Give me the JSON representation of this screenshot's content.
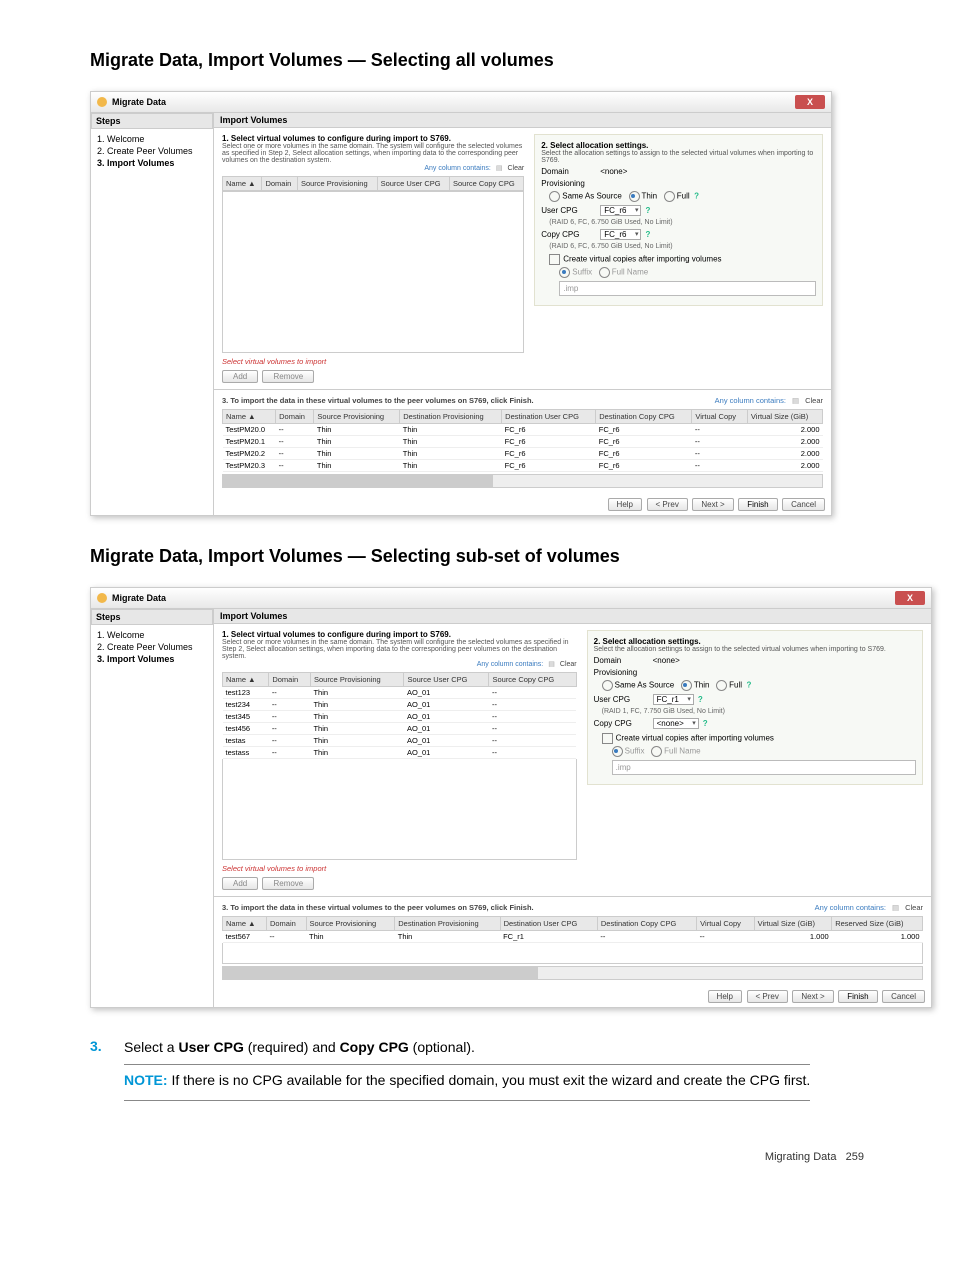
{
  "heading1": "Migrate Data, Import Volumes — Selecting all volumes",
  "heading2": "Migrate Data, Import Volumes — Selecting sub-set of volumes",
  "dlg": {
    "title": "Migrate Data",
    "close_x": "X",
    "steps_hdr": "Steps",
    "steps": [
      "1. Welcome",
      "2. Create Peer Volumes",
      "3. Import Volumes"
    ],
    "panel_hdr": "Import Volumes",
    "sec1_bold": "1. Select virtual volumes to configure during import to S769.",
    "sec1_line1": "Select one or more volumes in the same domain. The system will configure the selected volumes as specified in Step 2, Select allocation settings, when importing data to the corresponding peer volumes on the destination system.",
    "any_col": "Any column contains:",
    "clear": "Clear",
    "cols_top": [
      "Name ▲",
      "Domain",
      "Source Provisioning",
      "Source User CPG",
      "Source Copy CPG"
    ],
    "alloc_hdr": "2. Select allocation settings.",
    "alloc_sub": "Select the allocation settings to assign to the selected virtual volumes when importing to S769.",
    "domain_lbl": "Domain",
    "domain_val": "<none>",
    "prov_lbl": "Provisioning",
    "prov_same": "Same As Source",
    "prov_thin": "Thin",
    "prov_full": "Full",
    "usercpg_lbl": "User CPG",
    "usercpg_val": "FC_r6",
    "usercpg_hint": "(RAID 6, FC, 6.750 GiB Used, No Limit)",
    "copycpg_lbl": "Copy CPG",
    "copycpg_val": "FC_r6",
    "copycpg_hint": "(RAID 6, FC, 6.750 GiB Used, No Limit)",
    "create_vc": "Create virtual copies after importing volumes",
    "suffix": "Suffix",
    "fullname": "Full Name",
    "suffix_val": ".imp",
    "warn": "Select virtual volumes to import",
    "add": "Add",
    "remove": "Remove",
    "sec3": "3. To import the data in these virtual volumes to the peer volumes on S769, click Finish.",
    "cols_bot": [
      "Name ▲",
      "Domain",
      "Source Provisioning",
      "Destination Provisioning",
      "Destination User CPG",
      "Destination Copy CPG",
      "Virtual Copy",
      "Virtual Size (GiB)"
    ],
    "rows_bot": [
      {
        "n": "TestPM20.0",
        "d": "--",
        "sp": "Thin",
        "dp": "Thin",
        "duc": "FC_r6",
        "dcc": "FC_r6",
        "vc": "--",
        "sz": "2.000"
      },
      {
        "n": "TestPM20.1",
        "d": "--",
        "sp": "Thin",
        "dp": "Thin",
        "duc": "FC_r6",
        "dcc": "FC_r6",
        "vc": "--",
        "sz": "2.000"
      },
      {
        "n": "TestPM20.2",
        "d": "--",
        "sp": "Thin",
        "dp": "Thin",
        "duc": "FC_r6",
        "dcc": "FC_r6",
        "vc": "--",
        "sz": "2.000"
      },
      {
        "n": "TestPM20.3",
        "d": "--",
        "sp": "Thin",
        "dp": "Thin",
        "duc": "FC_r6",
        "dcc": "FC_r6",
        "vc": "--",
        "sz": "2.000"
      }
    ],
    "btns": {
      "help": "Help",
      "prev": "< Prev",
      "next": "Next >",
      "finish": "Finish",
      "cancel": "Cancel"
    }
  },
  "dlg2": {
    "sec1_line1": "Select one or more volumes in the same domain. The system will configure the selected volumes as specified in Step 2, Select allocation settings, when importing data to the corresponding peer volumes on the destination system.",
    "rows_top": [
      {
        "n": "test123",
        "d": "--",
        "sp": "Thin",
        "suc": "AO_01",
        "scc": "--"
      },
      {
        "n": "test234",
        "d": "--",
        "sp": "Thin",
        "suc": "AO_01",
        "scc": "--"
      },
      {
        "n": "test345",
        "d": "--",
        "sp": "Thin",
        "suc": "AO_01",
        "scc": "--"
      },
      {
        "n": "test456",
        "d": "--",
        "sp": "Thin",
        "suc": "AO_01",
        "scc": "--"
      },
      {
        "n": "testas",
        "d": "--",
        "sp": "Thin",
        "suc": "AO_01",
        "scc": "--"
      },
      {
        "n": "testass",
        "d": "--",
        "sp": "Thin",
        "suc": "AO_01",
        "scc": "--"
      }
    ],
    "alloc_sub": "Select the allocation settings to assign to the selected virtual volumes when importing to S769.",
    "usercpg_val": "FC_r1",
    "usercpg_hint": "(RAID 1, FC, 7.750 GiB Used, No Limit)",
    "copycpg_val": "<none>",
    "cols_bot": [
      "Name ▲",
      "Domain",
      "Source Provisioning",
      "Destination Provisioning",
      "Destination User CPG",
      "Destination Copy CPG",
      "Virtual Copy",
      "Virtual Size (GiB)",
      "Reserved Size (GiB)"
    ],
    "rows_bot": [
      {
        "n": "test567",
        "d": "--",
        "sp": "Thin",
        "dp": "Thin",
        "duc": "FC_r1",
        "dcc": "--",
        "vc": "--",
        "sz": "1.000",
        "rs": "1.000"
      }
    ]
  },
  "instr": {
    "num": "3.",
    "text_pre": "Select a ",
    "usercpg": "User CPG",
    "mid": " (required) and ",
    "copycpg": "Copy CPG",
    "post": " (optional).",
    "note_lbl": "NOTE:",
    "note_body": "   If there is no CPG available for the specified domain, you must exit the wizard and create the CPG first."
  },
  "footer": {
    "label": "Migrating Data",
    "page": "259"
  }
}
